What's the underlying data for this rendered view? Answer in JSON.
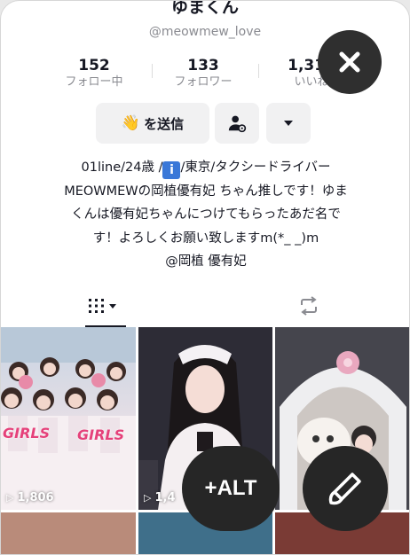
{
  "profile": {
    "display_name": "ゆまくん",
    "username": "@meowmew_love"
  },
  "stats": [
    {
      "value": "152",
      "label": "フォロー中"
    },
    {
      "value": "133",
      "label": "フォロワー"
    },
    {
      "value": "1,311",
      "label": "いいね"
    }
  ],
  "actions": {
    "send_label": "を送信",
    "send_emoji": "👋"
  },
  "bio": {
    "line1_prefix": "01line/24歳 /",
    "line1_suffix": "/東京/タクシードライバー",
    "line2": "MEOWMEWの岡植優有妃 ちゃん推しです！ゆま",
    "line3": "くんは優有妃ちゃんにつけてもらったあだ名で",
    "line4": "す！よろしくお願い致しますm(*_ _)m",
    "line5": "@岡植 優有妃",
    "pin_glyph": "i"
  },
  "videos": [
    {
      "views": "1,806",
      "caption_left": "GIRLS",
      "caption_right": "GIRLS"
    },
    {
      "views": "1,4"
    },
    {
      "views": ""
    }
  ],
  "overlay": {
    "alt_label": "+ALT"
  },
  "colors": {
    "accent_blue": "#3a78d8",
    "fab_bg": "#2f2f2f"
  },
  "icons": [
    "close-icon",
    "add-friend-icon",
    "caret-down-icon",
    "grid-icon",
    "repost-icon",
    "pencil-icon",
    "play-icon"
  ]
}
